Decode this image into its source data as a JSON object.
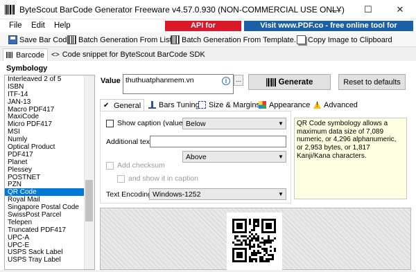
{
  "window": {
    "title": "ByteScout BarCode Generator Freeware v4.57.0.930 (NON-COMMERCIAL USE ONLY)",
    "minimize": "—",
    "maximize": "☐",
    "close": "✕"
  },
  "menu": {
    "file": "File",
    "edit": "Edit",
    "help": "Help",
    "api_badge": "API for programmers",
    "pdf_badge": "Visit www.PDF.co - free online tool for documents"
  },
  "toolbar": {
    "save": "Save Bar Code",
    "batch_list": "Batch Generation From List...",
    "batch_template": "Batch Generation From Template...",
    "copy_image": "Copy Image to Clipboard"
  },
  "tabs": {
    "barcode": "Barcode",
    "snippet": "Code snippet for ByteScout BarCode SDK"
  },
  "symbology": {
    "label": "Symbology",
    "items": [
      "Interleaved 2 of 5",
      "ISBN",
      "ITF-14",
      "JAN-13",
      "Macro PDF417",
      "MaxiCode",
      "Micro PDF417",
      "MSI",
      "Numly",
      "Optical Product",
      "PDF417",
      "Planet",
      "Plessey",
      "POSTNET",
      "PZN",
      "QR Code",
      "Royal Mail",
      "Singapore Postal Code",
      "SwissPost Parcel",
      "Telepen",
      "Truncated PDF417",
      "UPC-A",
      "UPC-E",
      "USPS Sack Label",
      "USPS Tray Label"
    ],
    "selected": "QR Code"
  },
  "value": {
    "label": "Value",
    "text": "thuthuatphanmem.vn",
    "dots": "..."
  },
  "buttons": {
    "generate": "Generate",
    "reset": "Reset to defaults"
  },
  "settings_tabs": {
    "general": "General",
    "bars_tuning": "Bars Tuning",
    "size_margins": "Size & Margins",
    "appearance": "Appearance",
    "advanced": "Advanced"
  },
  "general": {
    "show_caption": "Show caption (value)",
    "caption_position": "Below",
    "additional_text": "Additional text",
    "additional_position": "Above",
    "add_checksum": "Add checksum",
    "show_in_caption": "and show it in caption",
    "text_encoding_label": "Text Encoding:",
    "text_encoding": "Windows-1252"
  },
  "description": "QR Code symbology allows a maximum data size of 7,089 numeric, or 4,296 alphanumeric, or 2,953 bytes, or 1,817 Kanji/Kana characters.",
  "colors": {
    "api_red": "#d9182a",
    "pdf_blue": "#1b5fa8",
    "selection": "#0078d7",
    "tooltip_bg": "#ffffe1"
  }
}
